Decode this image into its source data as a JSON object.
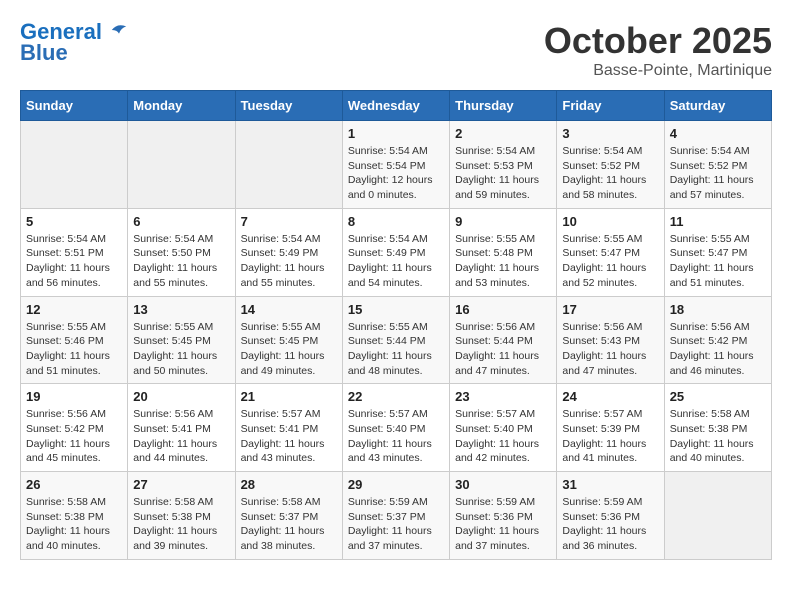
{
  "header": {
    "logo_line1": "General",
    "logo_line2": "Blue",
    "month": "October 2025",
    "location": "Basse-Pointe, Martinique"
  },
  "weekdays": [
    "Sunday",
    "Monday",
    "Tuesday",
    "Wednesday",
    "Thursday",
    "Friday",
    "Saturday"
  ],
  "weeks": [
    [
      {
        "day": "",
        "sunrise": "",
        "sunset": "",
        "daylight": ""
      },
      {
        "day": "",
        "sunrise": "",
        "sunset": "",
        "daylight": ""
      },
      {
        "day": "",
        "sunrise": "",
        "sunset": "",
        "daylight": ""
      },
      {
        "day": "1",
        "sunrise": "Sunrise: 5:54 AM",
        "sunset": "Sunset: 5:54 PM",
        "daylight": "Daylight: 12 hours and 0 minutes."
      },
      {
        "day": "2",
        "sunrise": "Sunrise: 5:54 AM",
        "sunset": "Sunset: 5:53 PM",
        "daylight": "Daylight: 11 hours and 59 minutes."
      },
      {
        "day": "3",
        "sunrise": "Sunrise: 5:54 AM",
        "sunset": "Sunset: 5:52 PM",
        "daylight": "Daylight: 11 hours and 58 minutes."
      },
      {
        "day": "4",
        "sunrise": "Sunrise: 5:54 AM",
        "sunset": "Sunset: 5:52 PM",
        "daylight": "Daylight: 11 hours and 57 minutes."
      }
    ],
    [
      {
        "day": "5",
        "sunrise": "Sunrise: 5:54 AM",
        "sunset": "Sunset: 5:51 PM",
        "daylight": "Daylight: 11 hours and 56 minutes."
      },
      {
        "day": "6",
        "sunrise": "Sunrise: 5:54 AM",
        "sunset": "Sunset: 5:50 PM",
        "daylight": "Daylight: 11 hours and 55 minutes."
      },
      {
        "day": "7",
        "sunrise": "Sunrise: 5:54 AM",
        "sunset": "Sunset: 5:49 PM",
        "daylight": "Daylight: 11 hours and 55 minutes."
      },
      {
        "day": "8",
        "sunrise": "Sunrise: 5:54 AM",
        "sunset": "Sunset: 5:49 PM",
        "daylight": "Daylight: 11 hours and 54 minutes."
      },
      {
        "day": "9",
        "sunrise": "Sunrise: 5:55 AM",
        "sunset": "Sunset: 5:48 PM",
        "daylight": "Daylight: 11 hours and 53 minutes."
      },
      {
        "day": "10",
        "sunrise": "Sunrise: 5:55 AM",
        "sunset": "Sunset: 5:47 PM",
        "daylight": "Daylight: 11 hours and 52 minutes."
      },
      {
        "day": "11",
        "sunrise": "Sunrise: 5:55 AM",
        "sunset": "Sunset: 5:47 PM",
        "daylight": "Daylight: 11 hours and 51 minutes."
      }
    ],
    [
      {
        "day": "12",
        "sunrise": "Sunrise: 5:55 AM",
        "sunset": "Sunset: 5:46 PM",
        "daylight": "Daylight: 11 hours and 51 minutes."
      },
      {
        "day": "13",
        "sunrise": "Sunrise: 5:55 AM",
        "sunset": "Sunset: 5:45 PM",
        "daylight": "Daylight: 11 hours and 50 minutes."
      },
      {
        "day": "14",
        "sunrise": "Sunrise: 5:55 AM",
        "sunset": "Sunset: 5:45 PM",
        "daylight": "Daylight: 11 hours and 49 minutes."
      },
      {
        "day": "15",
        "sunrise": "Sunrise: 5:55 AM",
        "sunset": "Sunset: 5:44 PM",
        "daylight": "Daylight: 11 hours and 48 minutes."
      },
      {
        "day": "16",
        "sunrise": "Sunrise: 5:56 AM",
        "sunset": "Sunset: 5:44 PM",
        "daylight": "Daylight: 11 hours and 47 minutes."
      },
      {
        "day": "17",
        "sunrise": "Sunrise: 5:56 AM",
        "sunset": "Sunset: 5:43 PM",
        "daylight": "Daylight: 11 hours and 47 minutes."
      },
      {
        "day": "18",
        "sunrise": "Sunrise: 5:56 AM",
        "sunset": "Sunset: 5:42 PM",
        "daylight": "Daylight: 11 hours and 46 minutes."
      }
    ],
    [
      {
        "day": "19",
        "sunrise": "Sunrise: 5:56 AM",
        "sunset": "Sunset: 5:42 PM",
        "daylight": "Daylight: 11 hours and 45 minutes."
      },
      {
        "day": "20",
        "sunrise": "Sunrise: 5:56 AM",
        "sunset": "Sunset: 5:41 PM",
        "daylight": "Daylight: 11 hours and 44 minutes."
      },
      {
        "day": "21",
        "sunrise": "Sunrise: 5:57 AM",
        "sunset": "Sunset: 5:41 PM",
        "daylight": "Daylight: 11 hours and 43 minutes."
      },
      {
        "day": "22",
        "sunrise": "Sunrise: 5:57 AM",
        "sunset": "Sunset: 5:40 PM",
        "daylight": "Daylight: 11 hours and 43 minutes."
      },
      {
        "day": "23",
        "sunrise": "Sunrise: 5:57 AM",
        "sunset": "Sunset: 5:40 PM",
        "daylight": "Daylight: 11 hours and 42 minutes."
      },
      {
        "day": "24",
        "sunrise": "Sunrise: 5:57 AM",
        "sunset": "Sunset: 5:39 PM",
        "daylight": "Daylight: 11 hours and 41 minutes."
      },
      {
        "day": "25",
        "sunrise": "Sunrise: 5:58 AM",
        "sunset": "Sunset: 5:38 PM",
        "daylight": "Daylight: 11 hours and 40 minutes."
      }
    ],
    [
      {
        "day": "26",
        "sunrise": "Sunrise: 5:58 AM",
        "sunset": "Sunset: 5:38 PM",
        "daylight": "Daylight: 11 hours and 40 minutes."
      },
      {
        "day": "27",
        "sunrise": "Sunrise: 5:58 AM",
        "sunset": "Sunset: 5:38 PM",
        "daylight": "Daylight: 11 hours and 39 minutes."
      },
      {
        "day": "28",
        "sunrise": "Sunrise: 5:58 AM",
        "sunset": "Sunset: 5:37 PM",
        "daylight": "Daylight: 11 hours and 38 minutes."
      },
      {
        "day": "29",
        "sunrise": "Sunrise: 5:59 AM",
        "sunset": "Sunset: 5:37 PM",
        "daylight": "Daylight: 11 hours and 37 minutes."
      },
      {
        "day": "30",
        "sunrise": "Sunrise: 5:59 AM",
        "sunset": "Sunset: 5:36 PM",
        "daylight": "Daylight: 11 hours and 37 minutes."
      },
      {
        "day": "31",
        "sunrise": "Sunrise: 5:59 AM",
        "sunset": "Sunset: 5:36 PM",
        "daylight": "Daylight: 11 hours and 36 minutes."
      },
      {
        "day": "",
        "sunrise": "",
        "sunset": "",
        "daylight": ""
      }
    ]
  ]
}
